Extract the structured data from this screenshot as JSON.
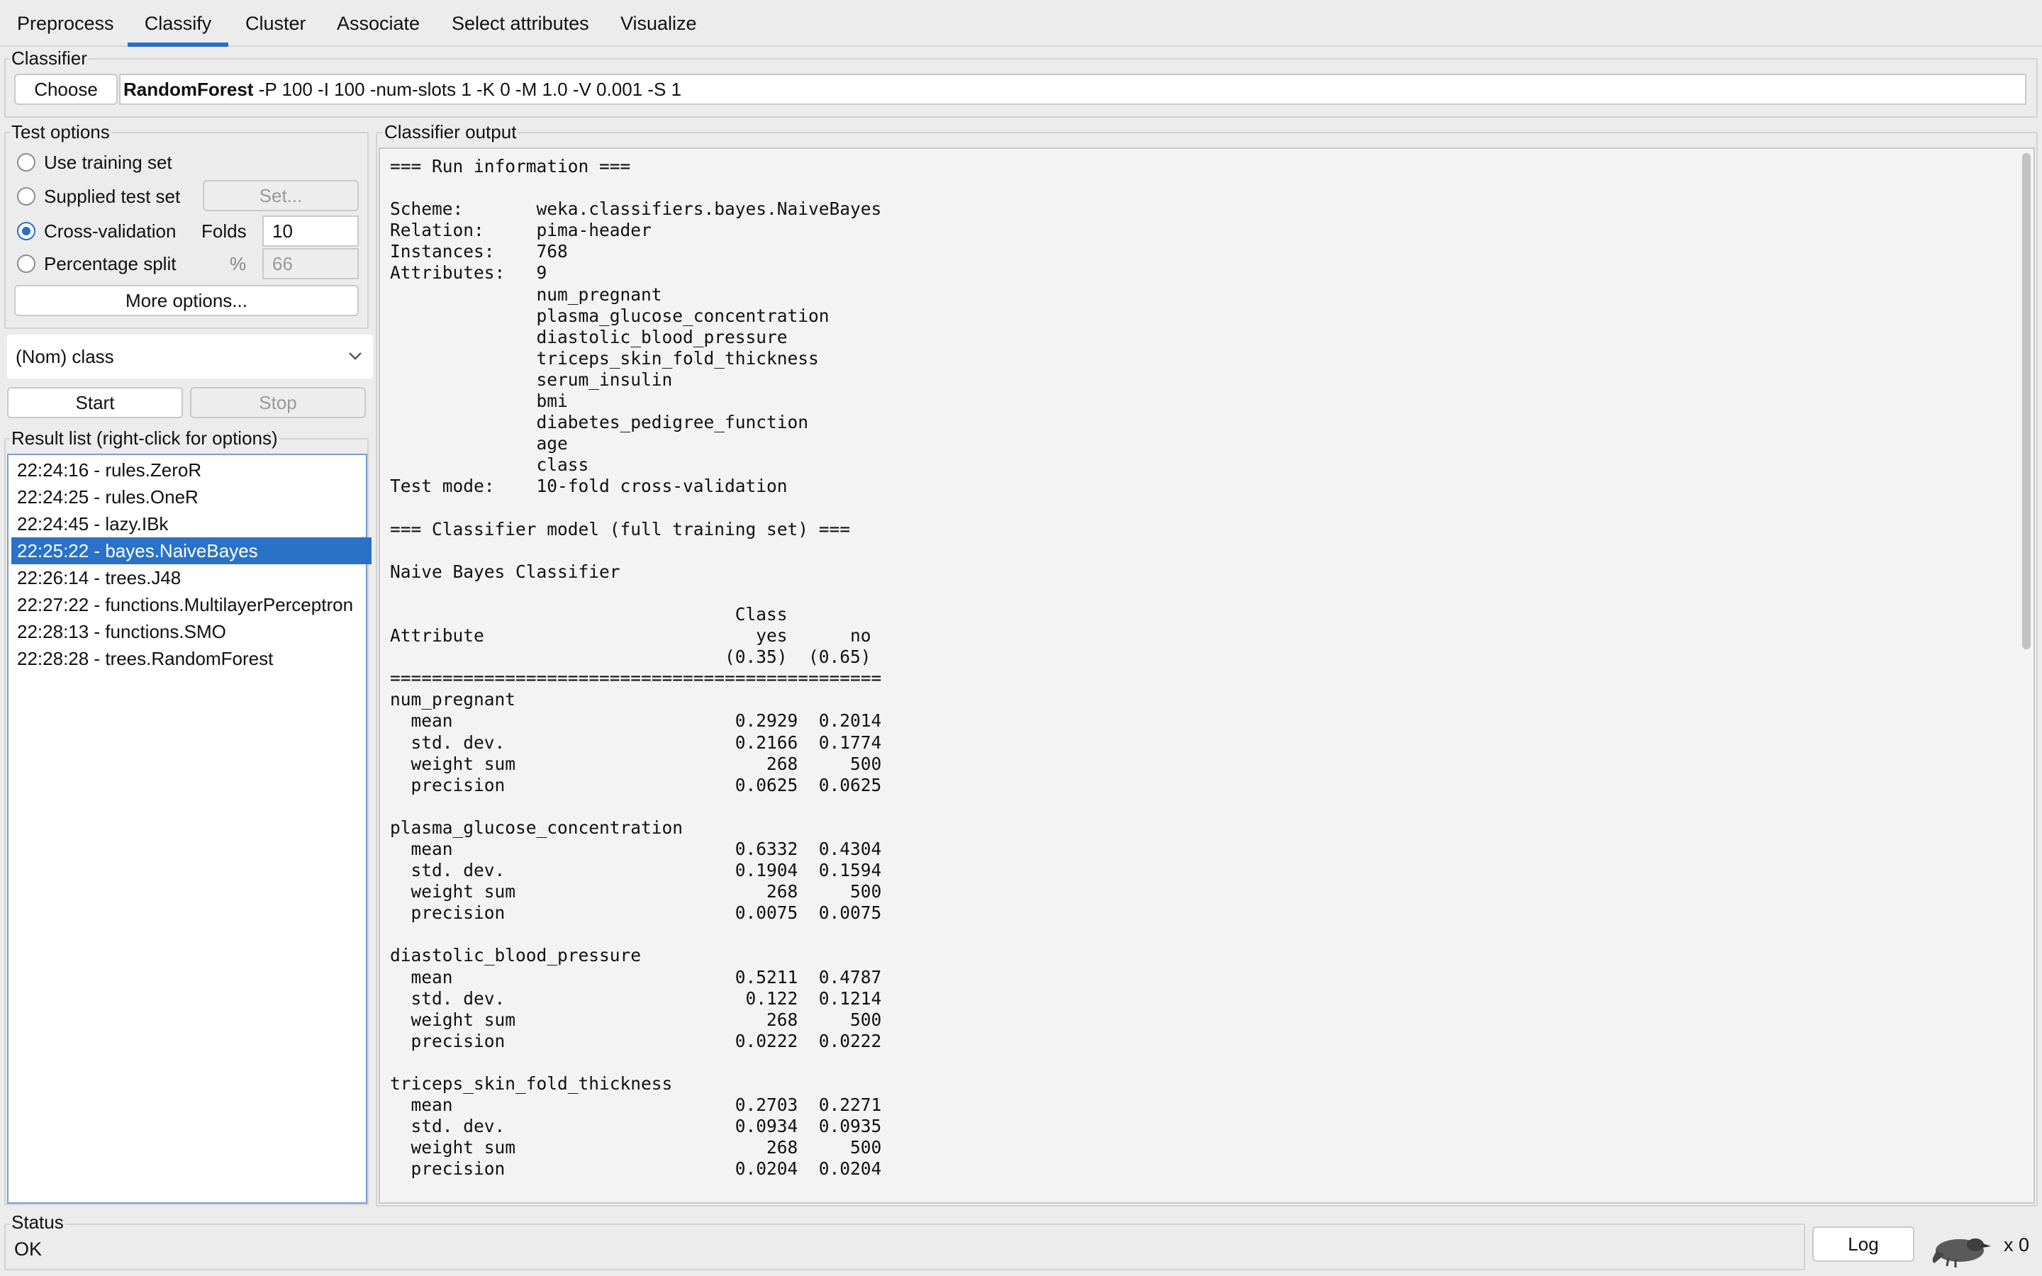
{
  "tabs": [
    "Preprocess",
    "Classify",
    "Cluster",
    "Associate",
    "Select attributes",
    "Visualize"
  ],
  "classifier": {
    "group_title": "Classifier",
    "choose_label": "Choose",
    "name": "RandomForest",
    "options": " -P 100 -I 100 -num-slots 1 -K 0 -M 1.0 -V 0.001 -S 1"
  },
  "test_options": {
    "group_title": "Test options",
    "use_training": "Use training set",
    "supplied_test": "Supplied test set",
    "set_label": "Set...",
    "cross_validation": "Cross-validation",
    "folds_label": "Folds",
    "folds_value": "10",
    "percentage_split": "Percentage split",
    "percent_sign": "%",
    "percent_value": "66",
    "more_options": "More options...",
    "selected": "Cross-validation"
  },
  "class_select": {
    "value": "(Nom) class"
  },
  "run": {
    "start_label": "Start",
    "stop_label": "Stop"
  },
  "result_list": {
    "title": "Result list (right-click for options)",
    "items": [
      "22:24:16 - rules.ZeroR",
      "22:24:25 - rules.OneR",
      "22:24:45 - lazy.IBk",
      "22:25:22 - bayes.NaiveBayes",
      "22:26:14 - trees.J48",
      "22:27:22 - functions.MultilayerPerceptron",
      "22:28:13 - functions.SMO",
      "22:28:28 - trees.RandomForest"
    ],
    "selected_index": 3
  },
  "output": {
    "title": "Classifier output",
    "text": "=== Run information ===\n\nScheme:       weka.classifiers.bayes.NaiveBayes\nRelation:     pima-header\nInstances:    768\nAttributes:   9\n              num_pregnant\n              plasma_glucose_concentration\n              diastolic_blood_pressure\n              triceps_skin_fold_thickness\n              serum_insulin\n              bmi\n              diabetes_pedigree_function\n              age\n              class\nTest mode:    10-fold cross-validation\n\n=== Classifier model (full training set) ===\n\nNaive Bayes Classifier\n\n                                 Class\nAttribute                          yes      no\n                                (0.35)  (0.65)\n===============================================\nnum_pregnant\n  mean                           0.2929  0.2014\n  std. dev.                      0.2166  0.1774\n  weight sum                        268     500\n  precision                      0.0625  0.0625\n\nplasma_glucose_concentration\n  mean                           0.6332  0.4304\n  std. dev.                      0.1904  0.1594\n  weight sum                        268     500\n  precision                      0.0075  0.0075\n\ndiastolic_blood_pressure\n  mean                           0.5211  0.4787\n  std. dev.                       0.122  0.1214\n  weight sum                        268     500\n  precision                      0.0222  0.0222\n\ntriceps_skin_fold_thickness\n  mean                           0.2703  0.2271\n  std. dev.                      0.0934  0.0935\n  weight sum                        268     500\n  precision                      0.0204  0.0204"
  },
  "status": {
    "title": "Status",
    "text": "OK",
    "log_label": "Log",
    "count": "x 0"
  },
  "colors": {
    "accent": "#2a6fc6",
    "selection": "#2a72c8"
  },
  "icons": {
    "class_dropdown": "chevron-down-icon",
    "status": "weka-bird-icon"
  }
}
